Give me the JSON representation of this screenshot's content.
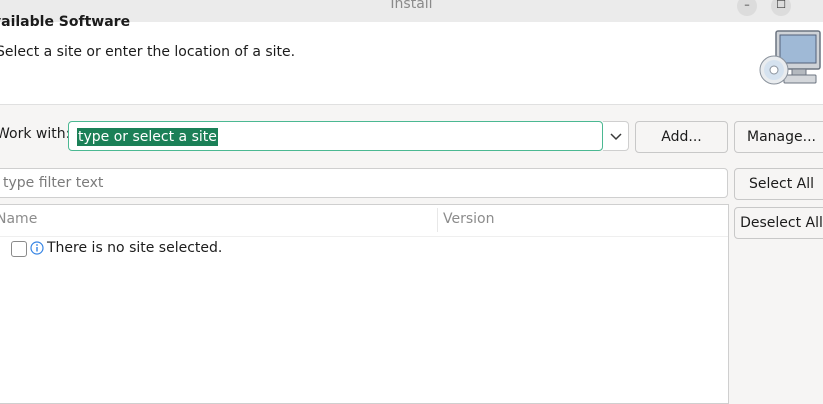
{
  "window": {
    "title": "Install",
    "minimize_glyph": "–",
    "maximize_glyph": "☐"
  },
  "header": {
    "title": "vailable Software",
    "description": "Select a site or enter the location of a site.",
    "graphic_icon": "computer-cd-icon"
  },
  "work_with": {
    "label": "Work with:",
    "value": "type or select a site",
    "add_label": "Add...",
    "manage_label": "Manage..."
  },
  "filter": {
    "placeholder": "type filter text"
  },
  "buttons": {
    "select_all": "Select All",
    "deselect_all": "Deselect All"
  },
  "table": {
    "columns": [
      "Name",
      "Version"
    ],
    "rows": [
      {
        "checked": false,
        "icon": "info-icon",
        "text": "There is no site selected."
      }
    ]
  },
  "colors": {
    "accent": "#1b8057",
    "focus_border": "#4bb892",
    "info_icon": "#3584e4"
  }
}
